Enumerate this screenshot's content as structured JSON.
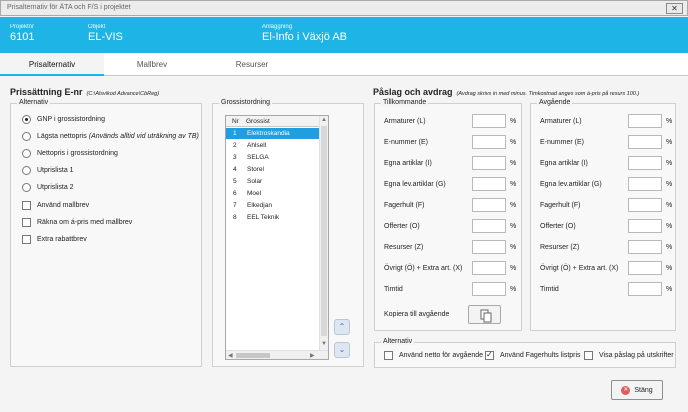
{
  "window": {
    "title": "Prisalternativ för ÄTA och F/S i projektet",
    "close_glyph": "✕"
  },
  "header": {
    "project_label": "Projektnr",
    "project_value": "6101",
    "object_label": "Objekt",
    "object_value": "EL-VIS",
    "facility_label": "Anläggning",
    "facility_value": "El-Info i Växjö AB"
  },
  "tabs": [
    {
      "label": "Prisalternativ"
    },
    {
      "label": "Mallbrev"
    },
    {
      "label": "Resurser"
    }
  ],
  "pricing": {
    "title": "Prissättning E-nr",
    "path": "(C:\\Alsvikod Advance\\CbReg)",
    "alternatives_legend": "Alternativ",
    "radios": [
      {
        "label": "GNP i grossistordning",
        "note": "",
        "selected": true
      },
      {
        "label": "Lägsta nettopris",
        "note": "(Används alltid vid uträkning av TB)",
        "selected": false
      },
      {
        "label": "Nettopris i grossistordning",
        "note": "",
        "selected": false
      },
      {
        "label": "Utprislista 1",
        "note": "",
        "selected": false
      },
      {
        "label": "Utprislista 2",
        "note": "",
        "selected": false
      }
    ],
    "checkboxes": [
      {
        "label": "Använd mallbrev",
        "checked": false
      },
      {
        "label": "Räkna om á-pris med mallbrev",
        "checked": false
      },
      {
        "label": "Extra rabattbrev",
        "checked": false
      }
    ]
  },
  "wholesalers": {
    "title": "Grossistordning",
    "col_nr": "Nr",
    "col_name": "Grossist",
    "rows": [
      {
        "nr": "1",
        "name": "Elektroskandia"
      },
      {
        "nr": "2",
        "name": "Ahlsell"
      },
      {
        "nr": "3",
        "name": "SELGA"
      },
      {
        "nr": "4",
        "name": "Storel"
      },
      {
        "nr": "5",
        "name": "Solar"
      },
      {
        "nr": "6",
        "name": "Moel"
      },
      {
        "nr": "7",
        "name": "Elkedjan"
      },
      {
        "nr": "8",
        "name": "EEL Teknik"
      }
    ],
    "selected_index": 0
  },
  "markup": {
    "title": "Påslag och avdrag",
    "note": "(Avdrag skrivs in med minus. Timkostnad anges som á-pris på resurs 100.)",
    "incoming_legend": "Tillkommande",
    "outgoing_legend": "Avgående",
    "percent": "%",
    "incoming_rows": [
      "Armaturer (L)",
      "E-nummer (E)",
      "Egna artiklar (I)",
      "Egna lev.artiklar (G)",
      "Fagerhult (F)",
      "Offerter (O)",
      "Resurser (Z)",
      "Övrigt (Ö) + Extra art. (X)",
      "Timtid"
    ],
    "outgoing_rows": [
      "Armaturer (L)",
      "E-nummer (E)",
      "Egna artiklar (I)",
      "Egna lev.artiklar (G)",
      "Fagerhult (F)",
      "Offerter (O)",
      "Resurser (Z)",
      "Övrigt (Ö) + Extra art. (X)",
      "Timtid"
    ],
    "copy_label": "Kopiera till avgående"
  },
  "options": {
    "legend": "Alternativ",
    "items": [
      {
        "label": "Använd netto för avgående",
        "checked": false
      },
      {
        "label": "Använd Fagerhults listpris",
        "checked": true
      },
      {
        "label": "Visa påslag på utskrifter",
        "checked": false
      }
    ]
  },
  "footer": {
    "close_label": "Stäng"
  }
}
